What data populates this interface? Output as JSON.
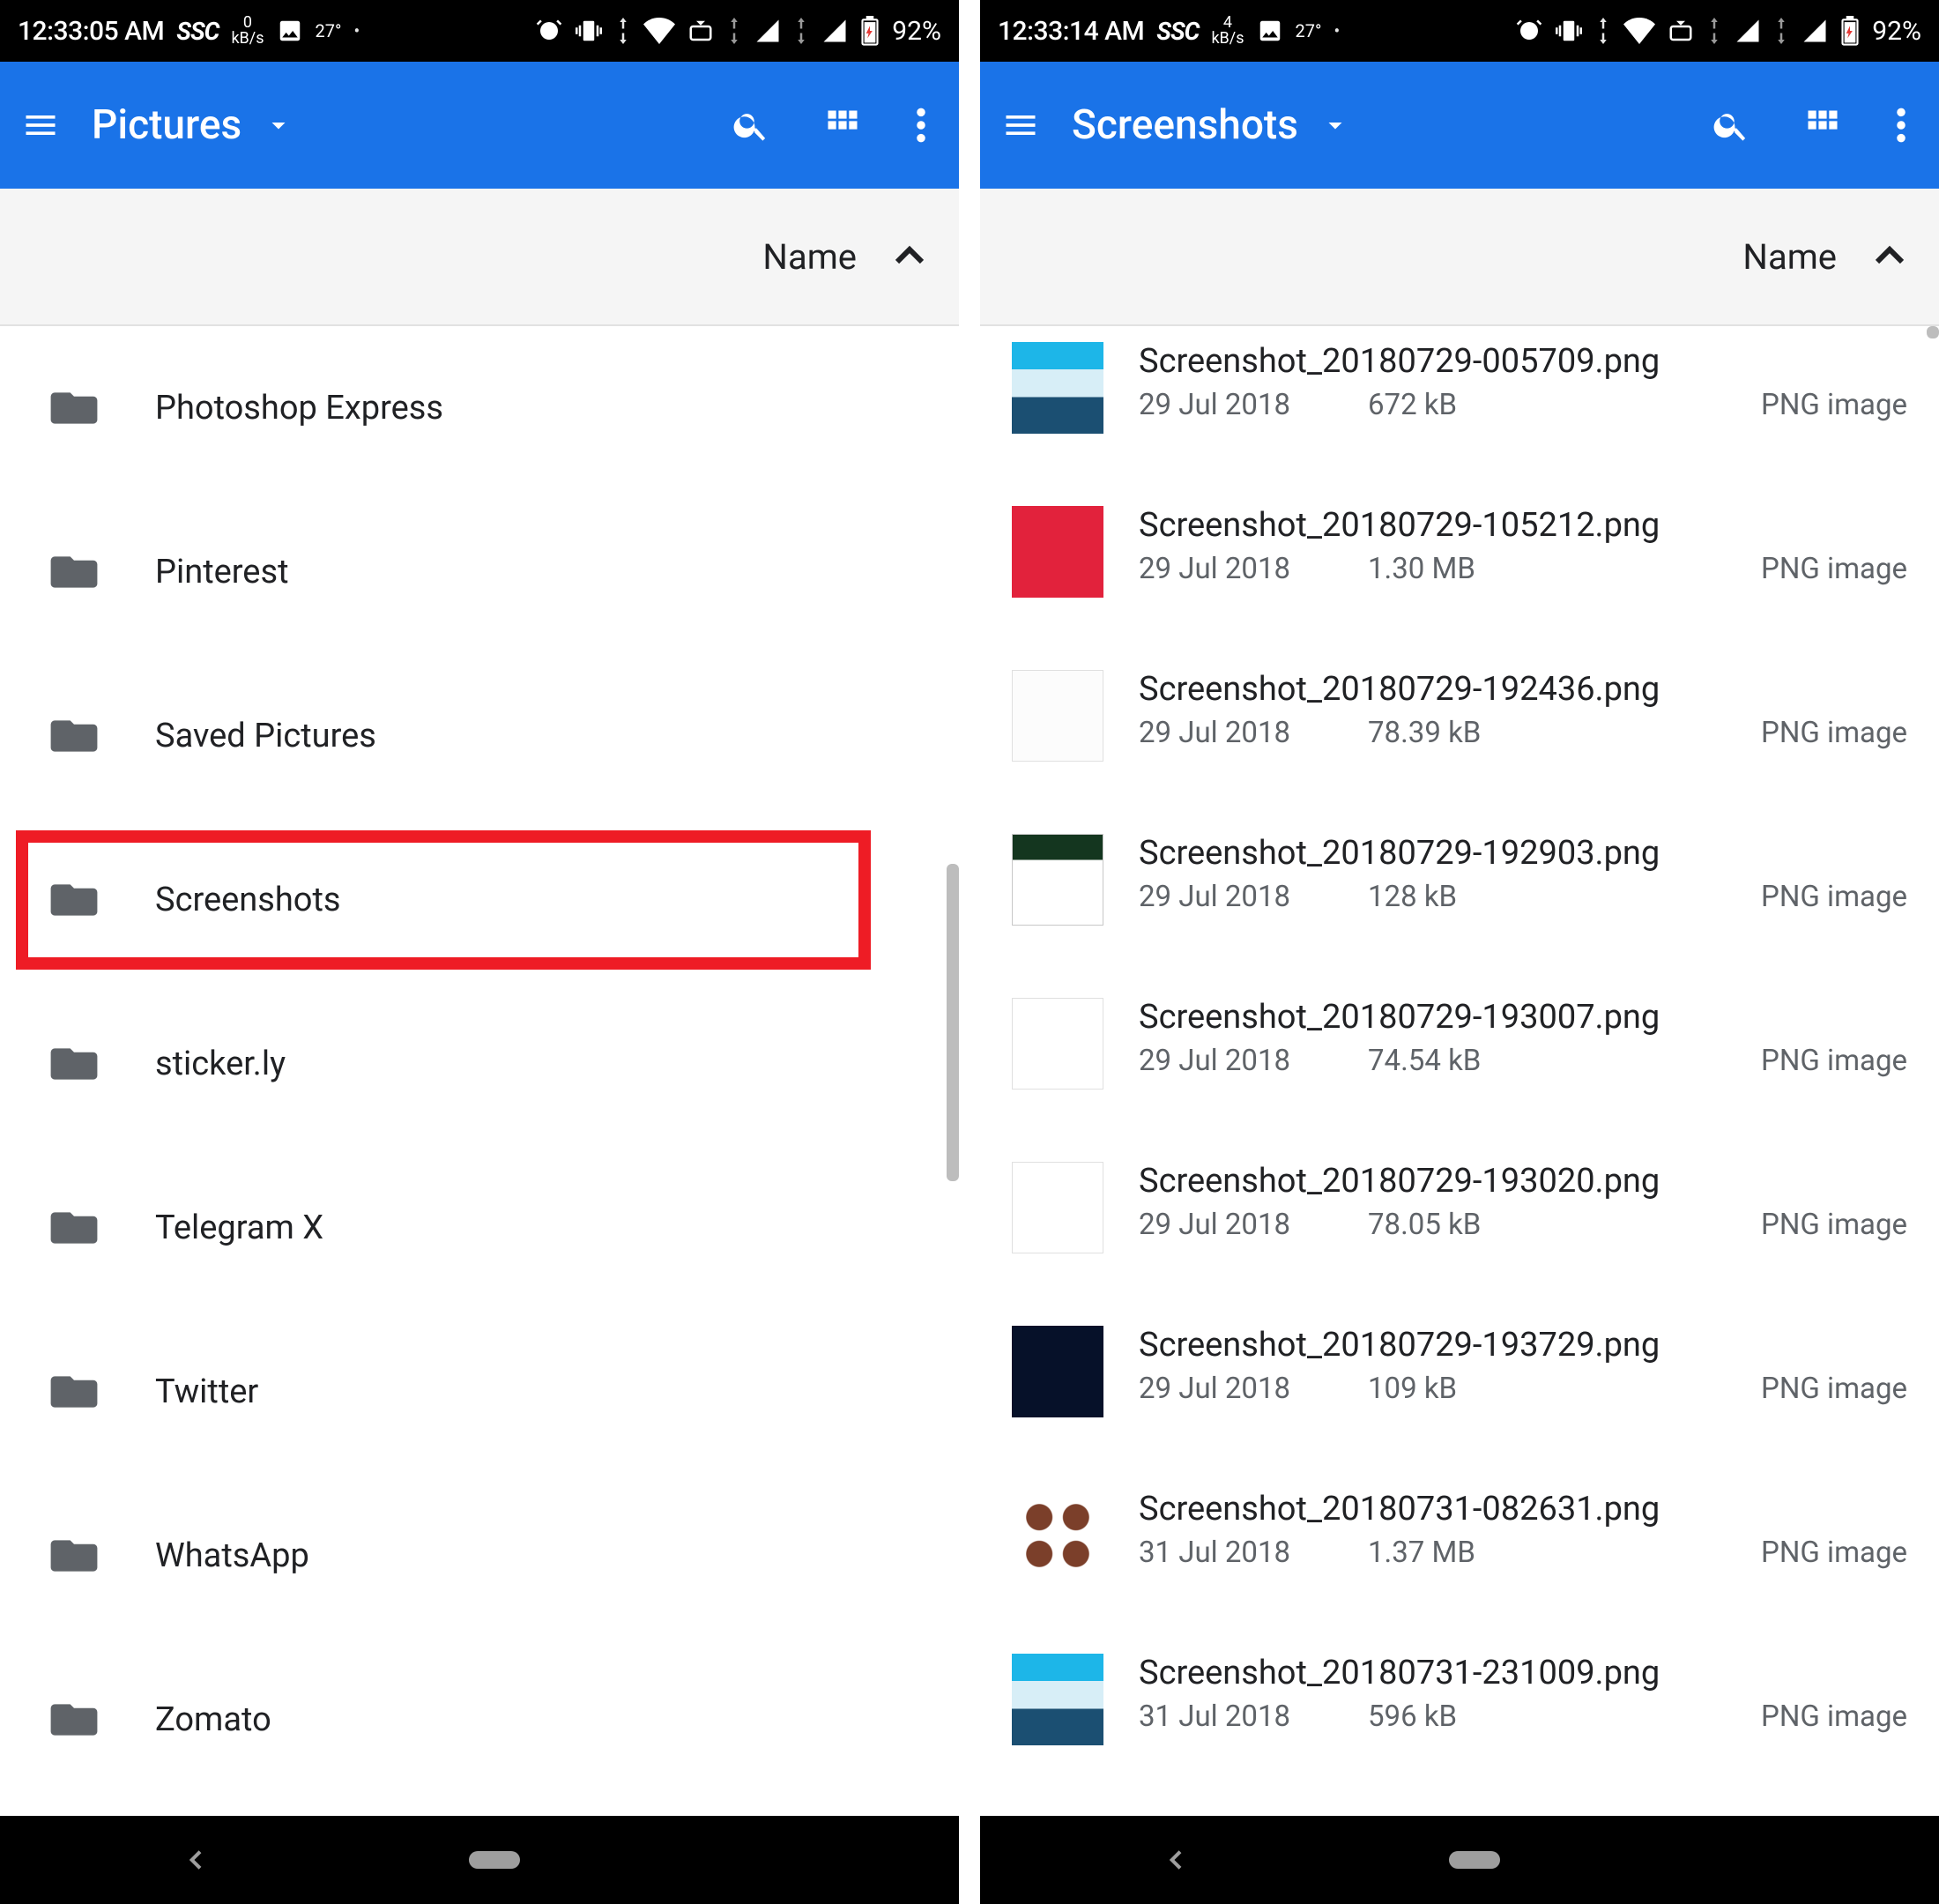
{
  "left": {
    "status": {
      "time": "12:33:05 AM",
      "ssc": "SSC",
      "kbs_num": "0",
      "kbs_unit": "kB/s",
      "temp": "27°",
      "battery": "92%"
    },
    "appbar": {
      "title": "Pictures"
    },
    "sort_label": "Name",
    "folders": [
      {
        "label": "Photoshop Express"
      },
      {
        "label": "Pinterest"
      },
      {
        "label": "Saved Pictures"
      },
      {
        "label": "Screenshots",
        "highlighted": true
      },
      {
        "label": "sticker.ly"
      },
      {
        "label": "Telegram X"
      },
      {
        "label": "Twitter"
      },
      {
        "label": "WhatsApp"
      },
      {
        "label": "Zomato"
      }
    ]
  },
  "right": {
    "status": {
      "time": "12:33:14 AM",
      "ssc": "SSC",
      "kbs_num": "4",
      "kbs_unit": "kB/s",
      "temp": "27°",
      "battery": "92%"
    },
    "appbar": {
      "title": "Screenshots"
    },
    "sort_label": "Name",
    "files": [
      {
        "name": "Screenshot_20180729-005709.png",
        "date": "29 Jul 2018",
        "size": "672 kB",
        "type": "PNG image"
      },
      {
        "name": "Screenshot_20180729-105212.png",
        "date": "29 Jul 2018",
        "size": "1.30 MB",
        "type": "PNG image"
      },
      {
        "name": "Screenshot_20180729-192436.png",
        "date": "29 Jul 2018",
        "size": "78.39 kB",
        "type": "PNG image"
      },
      {
        "name": "Screenshot_20180729-192903.png",
        "date": "29 Jul 2018",
        "size": "128 kB",
        "type": "PNG image"
      },
      {
        "name": "Screenshot_20180729-193007.png",
        "date": "29 Jul 2018",
        "size": "74.54 kB",
        "type": "PNG image"
      },
      {
        "name": "Screenshot_20180729-193020.png",
        "date": "29 Jul 2018",
        "size": "78.05 kB",
        "type": "PNG image"
      },
      {
        "name": "Screenshot_20180729-193729.png",
        "date": "29 Jul 2018",
        "size": "109 kB",
        "type": "PNG image"
      },
      {
        "name": "Screenshot_20180731-082631.png",
        "date": "31 Jul 2018",
        "size": "1.37 MB",
        "type": "PNG image"
      },
      {
        "name": "Screenshot_20180731-231009.png",
        "date": "31 Jul 2018",
        "size": "596 kB",
        "type": "PNG image"
      }
    ]
  }
}
